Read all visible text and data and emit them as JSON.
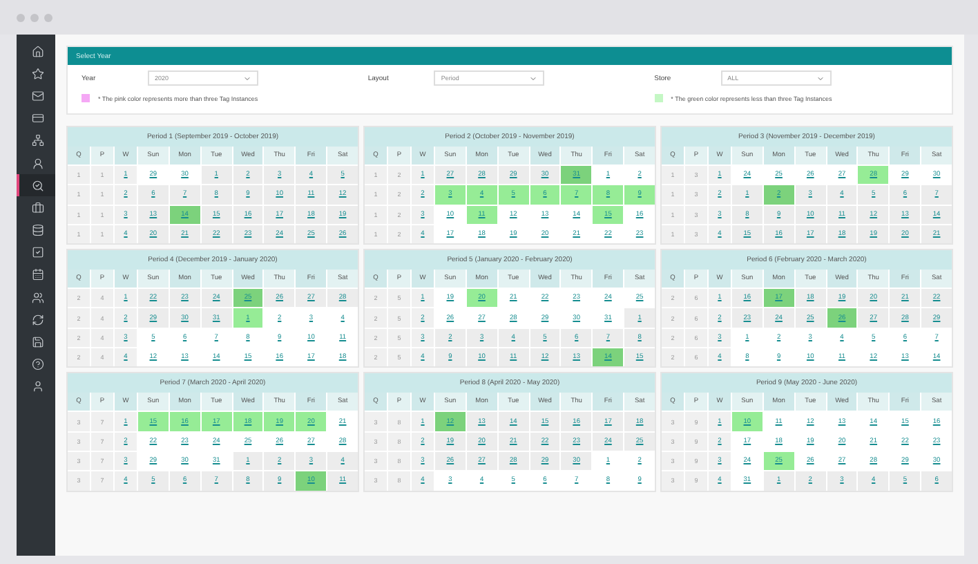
{
  "sidebar": {
    "items": [
      {
        "selected": false
      },
      {
        "selected": false
      },
      {
        "selected": false
      },
      {
        "selected": false
      },
      {
        "selected": false
      },
      {
        "selected": false
      },
      {
        "selected": true
      },
      {
        "selected": false
      },
      {
        "selected": false
      },
      {
        "selected": false
      },
      {
        "selected": false
      },
      {
        "selected": false
      },
      {
        "selected": false
      },
      {
        "selected": false
      },
      {
        "selected": false
      },
      {
        "selected": false
      }
    ]
  },
  "filter_panel": {
    "title": "Select Year",
    "fields": [
      {
        "label": "Year",
        "value": "2020"
      },
      {
        "label": "Layout",
        "value": "Period"
      },
      {
        "label": "Store",
        "value": "ALL"
      }
    ],
    "legend": [
      {
        "color": "#f5a8f5",
        "text": "* The pink color represents more than three Tag Instances"
      },
      {
        "color": "#c4f7c4",
        "text": "* The green color represents less than three Tag Instances"
      }
    ]
  },
  "periods": [
    {
      "title": "Period 1 (September 2019 - October 2019)",
      "columns": [
        "Q",
        "P",
        "W",
        "Sun",
        "Mon",
        "Tue",
        "Wed",
        "Thu",
        "Fri",
        "Sat"
      ],
      "weeks": [
        {
          "q": "1",
          "p": "1",
          "w": "1",
          "days": [
            {
              "day": "29",
              "shaded": false,
              "tagged": false
            },
            {
              "day": "30",
              "shaded": false,
              "tagged": false
            },
            {
              "day": "1",
              "shaded": true,
              "tagged": false
            },
            {
              "day": "2",
              "shaded": true,
              "tagged": false
            },
            {
              "day": "3",
              "shaded": true,
              "tagged": false
            },
            {
              "day": "4",
              "shaded": true,
              "tagged": false
            },
            {
              "day": "5",
              "shaded": true,
              "tagged": false
            }
          ]
        },
        {
          "q": "1",
          "p": "1",
          "w": "2",
          "days": [
            {
              "day": "6",
              "shaded": true,
              "tagged": false
            },
            {
              "day": "7",
              "shaded": true,
              "tagged": false
            },
            {
              "day": "8",
              "shaded": true,
              "tagged": false
            },
            {
              "day": "9",
              "shaded": true,
              "tagged": false
            },
            {
              "day": "10",
              "shaded": true,
              "tagged": false
            },
            {
              "day": "11",
              "shaded": true,
              "tagged": false
            },
            {
              "day": "12",
              "shaded": true,
              "tagged": false
            }
          ]
        },
        {
          "q": "1",
          "p": "1",
          "w": "3",
          "days": [
            {
              "day": "13",
              "shaded": true,
              "tagged": false
            },
            {
              "day": "14",
              "shaded": true,
              "tagged": true
            },
            {
              "day": "15",
              "shaded": true,
              "tagged": false
            },
            {
              "day": "16",
              "shaded": true,
              "tagged": false
            },
            {
              "day": "17",
              "shaded": true,
              "tagged": false
            },
            {
              "day": "18",
              "shaded": true,
              "tagged": false
            },
            {
              "day": "19",
              "shaded": true,
              "tagged": false
            }
          ]
        },
        {
          "q": "1",
          "p": "1",
          "w": "4",
          "days": [
            {
              "day": "20",
              "shaded": true,
              "tagged": false
            },
            {
              "day": "21",
              "shaded": true,
              "tagged": false
            },
            {
              "day": "22",
              "shaded": true,
              "tagged": false
            },
            {
              "day": "23",
              "shaded": true,
              "tagged": false
            },
            {
              "day": "24",
              "shaded": true,
              "tagged": false
            },
            {
              "day": "25",
              "shaded": true,
              "tagged": false
            },
            {
              "day": "26",
              "shaded": true,
              "tagged": false
            }
          ]
        }
      ]
    },
    {
      "title": "Period 2 (October 2019 - November 2019)",
      "columns": [
        "Q",
        "P",
        "W",
        "Sun",
        "Mon",
        "Tue",
        "Wed",
        "Thu",
        "Fri",
        "Sat"
      ],
      "weeks": [
        {
          "q": "1",
          "p": "2",
          "w": "1",
          "days": [
            {
              "day": "27",
              "shaded": true,
              "tagged": false
            },
            {
              "day": "28",
              "shaded": true,
              "tagged": false
            },
            {
              "day": "29",
              "shaded": true,
              "tagged": false
            },
            {
              "day": "30",
              "shaded": true,
              "tagged": false
            },
            {
              "day": "31",
              "shaded": true,
              "tagged": true
            },
            {
              "day": "1",
              "shaded": false,
              "tagged": false
            },
            {
              "day": "2",
              "shaded": false,
              "tagged": false
            }
          ]
        },
        {
          "q": "1",
          "p": "2",
          "w": "2",
          "days": [
            {
              "day": "3",
              "shaded": false,
              "tagged": true
            },
            {
              "day": "4",
              "shaded": false,
              "tagged": true
            },
            {
              "day": "5",
              "shaded": false,
              "tagged": true
            },
            {
              "day": "6",
              "shaded": false,
              "tagged": true
            },
            {
              "day": "7",
              "shaded": false,
              "tagged": true
            },
            {
              "day": "8",
              "shaded": false,
              "tagged": true
            },
            {
              "day": "9",
              "shaded": false,
              "tagged": true
            }
          ]
        },
        {
          "q": "1",
          "p": "2",
          "w": "3",
          "days": [
            {
              "day": "10",
              "shaded": false,
              "tagged": false
            },
            {
              "day": "11",
              "shaded": false,
              "tagged": true
            },
            {
              "day": "12",
              "shaded": false,
              "tagged": false
            },
            {
              "day": "13",
              "shaded": false,
              "tagged": false
            },
            {
              "day": "14",
              "shaded": false,
              "tagged": false
            },
            {
              "day": "15",
              "shaded": false,
              "tagged": true
            },
            {
              "day": "16",
              "shaded": false,
              "tagged": false
            }
          ]
        },
        {
          "q": "1",
          "p": "2",
          "w": "4",
          "days": [
            {
              "day": "17",
              "shaded": false,
              "tagged": false
            },
            {
              "day": "18",
              "shaded": false,
              "tagged": false
            },
            {
              "day": "19",
              "shaded": false,
              "tagged": false
            },
            {
              "day": "20",
              "shaded": false,
              "tagged": false
            },
            {
              "day": "21",
              "shaded": false,
              "tagged": false
            },
            {
              "day": "22",
              "shaded": false,
              "tagged": false
            },
            {
              "day": "23",
              "shaded": false,
              "tagged": false
            }
          ]
        }
      ]
    },
    {
      "title": "Period 3 (November 2019 - December 2019)",
      "columns": [
        "Q",
        "P",
        "W",
        "Sun",
        "Mon",
        "Tue",
        "Wed",
        "Thu",
        "Fri",
        "Sat"
      ],
      "weeks": [
        {
          "q": "1",
          "p": "3",
          "w": "1",
          "days": [
            {
              "day": "24",
              "shaded": false,
              "tagged": false
            },
            {
              "day": "25",
              "shaded": false,
              "tagged": false
            },
            {
              "day": "26",
              "shaded": false,
              "tagged": false
            },
            {
              "day": "27",
              "shaded": false,
              "tagged": false
            },
            {
              "day": "28",
              "shaded": false,
              "tagged": true
            },
            {
              "day": "29",
              "shaded": false,
              "tagged": false
            },
            {
              "day": "30",
              "shaded": false,
              "tagged": false
            }
          ]
        },
        {
          "q": "1",
          "p": "3",
          "w": "2",
          "days": [
            {
              "day": "1",
              "shaded": true,
              "tagged": false
            },
            {
              "day": "2",
              "shaded": true,
              "tagged": true
            },
            {
              "day": "3",
              "shaded": true,
              "tagged": false
            },
            {
              "day": "4",
              "shaded": true,
              "tagged": false
            },
            {
              "day": "5",
              "shaded": true,
              "tagged": false
            },
            {
              "day": "6",
              "shaded": true,
              "tagged": false
            },
            {
              "day": "7",
              "shaded": true,
              "tagged": false
            }
          ]
        },
        {
          "q": "1",
          "p": "3",
          "w": "3",
          "days": [
            {
              "day": "8",
              "shaded": true,
              "tagged": false
            },
            {
              "day": "9",
              "shaded": true,
              "tagged": false
            },
            {
              "day": "10",
              "shaded": true,
              "tagged": false
            },
            {
              "day": "11",
              "shaded": true,
              "tagged": false
            },
            {
              "day": "12",
              "shaded": true,
              "tagged": false
            },
            {
              "day": "13",
              "shaded": true,
              "tagged": false
            },
            {
              "day": "14",
              "shaded": true,
              "tagged": false
            }
          ]
        },
        {
          "q": "1",
          "p": "3",
          "w": "4",
          "days": [
            {
              "day": "15",
              "shaded": true,
              "tagged": false
            },
            {
              "day": "16",
              "shaded": true,
              "tagged": false
            },
            {
              "day": "17",
              "shaded": true,
              "tagged": false
            },
            {
              "day": "18",
              "shaded": true,
              "tagged": false
            },
            {
              "day": "19",
              "shaded": true,
              "tagged": false
            },
            {
              "day": "20",
              "shaded": true,
              "tagged": false
            },
            {
              "day": "21",
              "shaded": true,
              "tagged": false
            }
          ]
        }
      ]
    },
    {
      "title": "Period 4 (December 2019 - January 2020)",
      "columns": [
        "Q",
        "P",
        "W",
        "Sun",
        "Mon",
        "Tue",
        "Wed",
        "Thu",
        "Fri",
        "Sat"
      ],
      "weeks": [
        {
          "q": "2",
          "p": "4",
          "w": "1",
          "days": [
            {
              "day": "22",
              "shaded": true,
              "tagged": false
            },
            {
              "day": "23",
              "shaded": true,
              "tagged": false
            },
            {
              "day": "24",
              "shaded": true,
              "tagged": false
            },
            {
              "day": "25",
              "shaded": true,
              "tagged": true
            },
            {
              "day": "26",
              "shaded": true,
              "tagged": false
            },
            {
              "day": "27",
              "shaded": true,
              "tagged": false
            },
            {
              "day": "28",
              "shaded": true,
              "tagged": false
            }
          ]
        },
        {
          "q": "2",
          "p": "4",
          "w": "2",
          "days": [
            {
              "day": "29",
              "shaded": true,
              "tagged": false
            },
            {
              "day": "30",
              "shaded": true,
              "tagged": false
            },
            {
              "day": "31",
              "shaded": true,
              "tagged": false
            },
            {
              "day": "1",
              "shaded": false,
              "tagged": true
            },
            {
              "day": "2",
              "shaded": false,
              "tagged": false
            },
            {
              "day": "3",
              "shaded": false,
              "tagged": false
            },
            {
              "day": "4",
              "shaded": false,
              "tagged": false
            }
          ]
        },
        {
          "q": "2",
          "p": "4",
          "w": "3",
          "days": [
            {
              "day": "5",
              "shaded": false,
              "tagged": false
            },
            {
              "day": "6",
              "shaded": false,
              "tagged": false
            },
            {
              "day": "7",
              "shaded": false,
              "tagged": false
            },
            {
              "day": "8",
              "shaded": false,
              "tagged": false
            },
            {
              "day": "9",
              "shaded": false,
              "tagged": false
            },
            {
              "day": "10",
              "shaded": false,
              "tagged": false
            },
            {
              "day": "11",
              "shaded": false,
              "tagged": false
            }
          ]
        },
        {
          "q": "2",
          "p": "4",
          "w": "4",
          "days": [
            {
              "day": "12",
              "shaded": false,
              "tagged": false
            },
            {
              "day": "13",
              "shaded": false,
              "tagged": false
            },
            {
              "day": "14",
              "shaded": false,
              "tagged": false
            },
            {
              "day": "15",
              "shaded": false,
              "tagged": false
            },
            {
              "day": "16",
              "shaded": false,
              "tagged": false
            },
            {
              "day": "17",
              "shaded": false,
              "tagged": false
            },
            {
              "day": "18",
              "shaded": false,
              "tagged": false
            }
          ]
        }
      ]
    },
    {
      "title": "Period 5 (January 2020 - February 2020)",
      "columns": [
        "Q",
        "P",
        "W",
        "Sun",
        "Mon",
        "Tue",
        "Wed",
        "Thu",
        "Fri",
        "Sat"
      ],
      "weeks": [
        {
          "q": "2",
          "p": "5",
          "w": "1",
          "days": [
            {
              "day": "19",
              "shaded": false,
              "tagged": false
            },
            {
              "day": "20",
              "shaded": false,
              "tagged": true
            },
            {
              "day": "21",
              "shaded": false,
              "tagged": false
            },
            {
              "day": "22",
              "shaded": false,
              "tagged": false
            },
            {
              "day": "23",
              "shaded": false,
              "tagged": false
            },
            {
              "day": "24",
              "shaded": false,
              "tagged": false
            },
            {
              "day": "25",
              "shaded": false,
              "tagged": false
            }
          ]
        },
        {
          "q": "2",
          "p": "5",
          "w": "2",
          "days": [
            {
              "day": "26",
              "shaded": false,
              "tagged": false
            },
            {
              "day": "27",
              "shaded": false,
              "tagged": false
            },
            {
              "day": "28",
              "shaded": false,
              "tagged": false
            },
            {
              "day": "29",
              "shaded": false,
              "tagged": false
            },
            {
              "day": "30",
              "shaded": false,
              "tagged": false
            },
            {
              "day": "31",
              "shaded": false,
              "tagged": false
            },
            {
              "day": "1",
              "shaded": true,
              "tagged": false
            }
          ]
        },
        {
          "q": "2",
          "p": "5",
          "w": "3",
          "days": [
            {
              "day": "2",
              "shaded": true,
              "tagged": false
            },
            {
              "day": "3",
              "shaded": true,
              "tagged": false
            },
            {
              "day": "4",
              "shaded": true,
              "tagged": false
            },
            {
              "day": "5",
              "shaded": true,
              "tagged": false
            },
            {
              "day": "6",
              "shaded": true,
              "tagged": false
            },
            {
              "day": "7",
              "shaded": true,
              "tagged": false
            },
            {
              "day": "8",
              "shaded": true,
              "tagged": false
            }
          ]
        },
        {
          "q": "2",
          "p": "5",
          "w": "4",
          "days": [
            {
              "day": "9",
              "shaded": true,
              "tagged": false
            },
            {
              "day": "10",
              "shaded": true,
              "tagged": false
            },
            {
              "day": "11",
              "shaded": true,
              "tagged": false
            },
            {
              "day": "12",
              "shaded": true,
              "tagged": false
            },
            {
              "day": "13",
              "shaded": true,
              "tagged": false
            },
            {
              "day": "14",
              "shaded": true,
              "tagged": true
            },
            {
              "day": "15",
              "shaded": true,
              "tagged": false
            }
          ]
        }
      ]
    },
    {
      "title": "Period 6 (February 2020 - March 2020)",
      "columns": [
        "Q",
        "P",
        "W",
        "Sun",
        "Mon",
        "Tue",
        "Wed",
        "Thu",
        "Fri",
        "Sat"
      ],
      "weeks": [
        {
          "q": "2",
          "p": "6",
          "w": "1",
          "days": [
            {
              "day": "16",
              "shaded": true,
              "tagged": false
            },
            {
              "day": "17",
              "shaded": true,
              "tagged": true
            },
            {
              "day": "18",
              "shaded": true,
              "tagged": false
            },
            {
              "day": "19",
              "shaded": true,
              "tagged": false
            },
            {
              "day": "20",
              "shaded": true,
              "tagged": false
            },
            {
              "day": "21",
              "shaded": true,
              "tagged": false
            },
            {
              "day": "22",
              "shaded": true,
              "tagged": false
            }
          ]
        },
        {
          "q": "2",
          "p": "6",
          "w": "2",
          "days": [
            {
              "day": "23",
              "shaded": true,
              "tagged": false
            },
            {
              "day": "24",
              "shaded": true,
              "tagged": false
            },
            {
              "day": "25",
              "shaded": true,
              "tagged": false
            },
            {
              "day": "26",
              "shaded": true,
              "tagged": true
            },
            {
              "day": "27",
              "shaded": true,
              "tagged": false
            },
            {
              "day": "28",
              "shaded": true,
              "tagged": false
            },
            {
              "day": "29",
              "shaded": true,
              "tagged": false
            }
          ]
        },
        {
          "q": "2",
          "p": "6",
          "w": "3",
          "days": [
            {
              "day": "1",
              "shaded": false,
              "tagged": false
            },
            {
              "day": "2",
              "shaded": false,
              "tagged": false
            },
            {
              "day": "3",
              "shaded": false,
              "tagged": false
            },
            {
              "day": "4",
              "shaded": false,
              "tagged": false
            },
            {
              "day": "5",
              "shaded": false,
              "tagged": false
            },
            {
              "day": "6",
              "shaded": false,
              "tagged": false
            },
            {
              "day": "7",
              "shaded": false,
              "tagged": false
            }
          ]
        },
        {
          "q": "2",
          "p": "6",
          "w": "4",
          "days": [
            {
              "day": "8",
              "shaded": false,
              "tagged": false
            },
            {
              "day": "9",
              "shaded": false,
              "tagged": false
            },
            {
              "day": "10",
              "shaded": false,
              "tagged": false
            },
            {
              "day": "11",
              "shaded": false,
              "tagged": false
            },
            {
              "day": "12",
              "shaded": false,
              "tagged": false
            },
            {
              "day": "13",
              "shaded": false,
              "tagged": false
            },
            {
              "day": "14",
              "shaded": false,
              "tagged": false
            }
          ]
        }
      ]
    },
    {
      "title": "Period 7 (March 2020 - April 2020)",
      "columns": [
        "Q",
        "P",
        "W",
        "Sun",
        "Mon",
        "Tue",
        "Wed",
        "Thu",
        "Fri",
        "Sat"
      ],
      "weeks": [
        {
          "q": "3",
          "p": "7",
          "w": "1",
          "days": [
            {
              "day": "15",
              "shaded": false,
              "tagged": true
            },
            {
              "day": "16",
              "shaded": false,
              "tagged": true
            },
            {
              "day": "17",
              "shaded": false,
              "tagged": true
            },
            {
              "day": "18",
              "shaded": false,
              "tagged": true
            },
            {
              "day": "19",
              "shaded": false,
              "tagged": true
            },
            {
              "day": "20",
              "shaded": false,
              "tagged": true
            },
            {
              "day": "21",
              "shaded": false,
              "tagged": false
            }
          ]
        },
        {
          "q": "3",
          "p": "7",
          "w": "2",
          "days": [
            {
              "day": "22",
              "shaded": false,
              "tagged": false
            },
            {
              "day": "23",
              "shaded": false,
              "tagged": false
            },
            {
              "day": "24",
              "shaded": false,
              "tagged": false
            },
            {
              "day": "25",
              "shaded": false,
              "tagged": false
            },
            {
              "day": "26",
              "shaded": false,
              "tagged": false
            },
            {
              "day": "27",
              "shaded": false,
              "tagged": false
            },
            {
              "day": "28",
              "shaded": false,
              "tagged": false
            }
          ]
        },
        {
          "q": "3",
          "p": "7",
          "w": "3",
          "days": [
            {
              "day": "29",
              "shaded": false,
              "tagged": false
            },
            {
              "day": "30",
              "shaded": false,
              "tagged": false
            },
            {
              "day": "31",
              "shaded": false,
              "tagged": false
            },
            {
              "day": "1",
              "shaded": true,
              "tagged": false
            },
            {
              "day": "2",
              "shaded": true,
              "tagged": false
            },
            {
              "day": "3",
              "shaded": true,
              "tagged": false
            },
            {
              "day": "4",
              "shaded": true,
              "tagged": false
            }
          ]
        },
        {
          "q": "3",
          "p": "7",
          "w": "4",
          "days": [
            {
              "day": "5",
              "shaded": true,
              "tagged": false
            },
            {
              "day": "6",
              "shaded": true,
              "tagged": false
            },
            {
              "day": "7",
              "shaded": true,
              "tagged": false
            },
            {
              "day": "8",
              "shaded": true,
              "tagged": false
            },
            {
              "day": "9",
              "shaded": true,
              "tagged": false
            },
            {
              "day": "10",
              "shaded": true,
              "tagged": true
            },
            {
              "day": "11",
              "shaded": true,
              "tagged": false
            }
          ]
        }
      ]
    },
    {
      "title": "Period 8 (April 2020 - May 2020)",
      "columns": [
        "Q",
        "P",
        "W",
        "Sun",
        "Mon",
        "Tue",
        "Wed",
        "Thu",
        "Fri",
        "Sat"
      ],
      "weeks": [
        {
          "q": "3",
          "p": "8",
          "w": "1",
          "days": [
            {
              "day": "12",
              "shaded": true,
              "tagged": true
            },
            {
              "day": "13",
              "shaded": true,
              "tagged": false
            },
            {
              "day": "14",
              "shaded": true,
              "tagged": false
            },
            {
              "day": "15",
              "shaded": true,
              "tagged": false
            },
            {
              "day": "16",
              "shaded": true,
              "tagged": false
            },
            {
              "day": "17",
              "shaded": true,
              "tagged": false
            },
            {
              "day": "18",
              "shaded": true,
              "tagged": false
            }
          ]
        },
        {
          "q": "3",
          "p": "8",
          "w": "2",
          "days": [
            {
              "day": "19",
              "shaded": true,
              "tagged": false
            },
            {
              "day": "20",
              "shaded": true,
              "tagged": false
            },
            {
              "day": "21",
              "shaded": true,
              "tagged": false
            },
            {
              "day": "22",
              "shaded": true,
              "tagged": false
            },
            {
              "day": "23",
              "shaded": true,
              "tagged": false
            },
            {
              "day": "24",
              "shaded": true,
              "tagged": false
            },
            {
              "day": "25",
              "shaded": true,
              "tagged": false
            }
          ]
        },
        {
          "q": "3",
          "p": "8",
          "w": "3",
          "days": [
            {
              "day": "26",
              "shaded": true,
              "tagged": false
            },
            {
              "day": "27",
              "shaded": true,
              "tagged": false
            },
            {
              "day": "28",
              "shaded": true,
              "tagged": false
            },
            {
              "day": "29",
              "shaded": true,
              "tagged": false
            },
            {
              "day": "30",
              "shaded": true,
              "tagged": false
            },
            {
              "day": "1",
              "shaded": false,
              "tagged": false
            },
            {
              "day": "2",
              "shaded": false,
              "tagged": false
            }
          ]
        },
        {
          "q": "3",
          "p": "8",
          "w": "4",
          "days": [
            {
              "day": "3",
              "shaded": false,
              "tagged": false
            },
            {
              "day": "4",
              "shaded": false,
              "tagged": false
            },
            {
              "day": "5",
              "shaded": false,
              "tagged": false
            },
            {
              "day": "6",
              "shaded": false,
              "tagged": false
            },
            {
              "day": "7",
              "shaded": false,
              "tagged": false
            },
            {
              "day": "8",
              "shaded": false,
              "tagged": false
            },
            {
              "day": "9",
              "shaded": false,
              "tagged": false
            }
          ]
        }
      ]
    },
    {
      "title": "Period 9 (May 2020 - June 2020)",
      "columns": [
        "Q",
        "P",
        "W",
        "Sun",
        "Mon",
        "Tue",
        "Wed",
        "Thu",
        "Fri",
        "Sat"
      ],
      "weeks": [
        {
          "q": "3",
          "p": "9",
          "w": "1",
          "days": [
            {
              "day": "10",
              "shaded": false,
              "tagged": true
            },
            {
              "day": "11",
              "shaded": false,
              "tagged": false
            },
            {
              "day": "12",
              "shaded": false,
              "tagged": false
            },
            {
              "day": "13",
              "shaded": false,
              "tagged": false
            },
            {
              "day": "14",
              "shaded": false,
              "tagged": false
            },
            {
              "day": "15",
              "shaded": false,
              "tagged": false
            },
            {
              "day": "16",
              "shaded": false,
              "tagged": false
            }
          ]
        },
        {
          "q": "3",
          "p": "9",
          "w": "2",
          "days": [
            {
              "day": "17",
              "shaded": false,
              "tagged": false
            },
            {
              "day": "18",
              "shaded": false,
              "tagged": false
            },
            {
              "day": "19",
              "shaded": false,
              "tagged": false
            },
            {
              "day": "20",
              "shaded": false,
              "tagged": false
            },
            {
              "day": "21",
              "shaded": false,
              "tagged": false
            },
            {
              "day": "22",
              "shaded": false,
              "tagged": false
            },
            {
              "day": "23",
              "shaded": false,
              "tagged": false
            }
          ]
        },
        {
          "q": "3",
          "p": "9",
          "w": "3",
          "days": [
            {
              "day": "24",
              "shaded": false,
              "tagged": false
            },
            {
              "day": "25",
              "shaded": false,
              "tagged": true
            },
            {
              "day": "26",
              "shaded": false,
              "tagged": false
            },
            {
              "day": "27",
              "shaded": false,
              "tagged": false
            },
            {
              "day": "28",
              "shaded": false,
              "tagged": false
            },
            {
              "day": "29",
              "shaded": false,
              "tagged": false
            },
            {
              "day": "30",
              "shaded": false,
              "tagged": false
            }
          ]
        },
        {
          "q": "3",
          "p": "9",
          "w": "4",
          "days": [
            {
              "day": "31",
              "shaded": false,
              "tagged": false
            },
            {
              "day": "1",
              "shaded": true,
              "tagged": false
            },
            {
              "day": "2",
              "shaded": true,
              "tagged": false
            },
            {
              "day": "3",
              "shaded": true,
              "tagged": false
            },
            {
              "day": "4",
              "shaded": true,
              "tagged": false
            },
            {
              "day": "5",
              "shaded": true,
              "tagged": false
            },
            {
              "day": "6",
              "shaded": true,
              "tagged": false
            }
          ]
        }
      ]
    }
  ]
}
